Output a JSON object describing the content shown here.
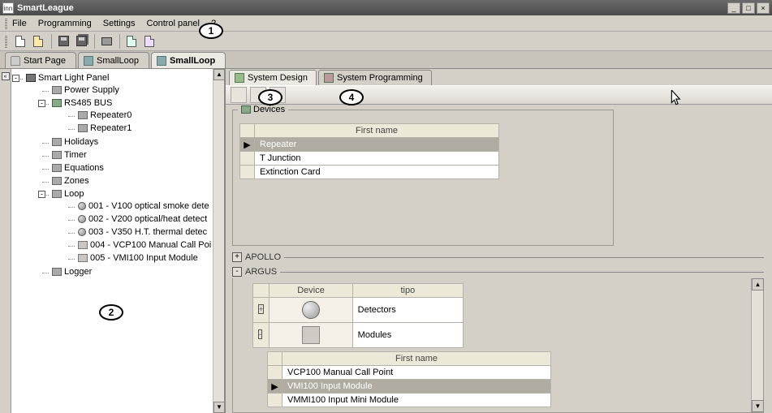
{
  "window": {
    "title": "SmartLeague",
    "appicon_text": "inn"
  },
  "menu": {
    "items": [
      "File",
      "Programming",
      "Settings",
      "Control panel",
      "?"
    ]
  },
  "callouts": {
    "c1": "1",
    "c2": "2",
    "c3": "3",
    "c4": "4"
  },
  "docTabs": [
    {
      "id": "startpage",
      "label": "Start Page",
      "active": false,
      "icon": "home-icon"
    },
    {
      "id": "smallloop1",
      "label": "SmallLoop",
      "active": false,
      "icon": "panel-icon"
    },
    {
      "id": "smallloop2",
      "label": "SmallLoop",
      "active": true,
      "icon": "panel-icon"
    }
  ],
  "tree": {
    "root": {
      "label": "Smart Light Panel",
      "children": [
        {
          "label": "Power Supply",
          "icon": "item"
        },
        {
          "label": "RS485 BUS",
          "icon": "bus",
          "expander": "-",
          "children": [
            {
              "label": "Repeater0",
              "icon": "item"
            },
            {
              "label": "Repeater1",
              "icon": "item"
            }
          ]
        },
        {
          "label": "Holidays",
          "icon": "item"
        },
        {
          "label": "Timer",
          "icon": "item"
        },
        {
          "label": "Equations",
          "icon": "item"
        },
        {
          "label": "Zones",
          "icon": "item"
        },
        {
          "label": "Loop",
          "icon": "item",
          "expander": "-",
          "children": [
            {
              "label": "001 - V100 optical smoke dete",
              "icon": "ball"
            },
            {
              "label": "002 - V200 optical/heat detect",
              "icon": "ball"
            },
            {
              "label": "003 - V350 H.T. thermal detec",
              "icon": "ball"
            },
            {
              "label": "004 - VCP100 Manual Call Poi",
              "icon": "mod"
            },
            {
              "label": "005 - VMI100 Input Module",
              "icon": "mod"
            }
          ]
        },
        {
          "label": "Logger",
          "icon": "item"
        }
      ]
    }
  },
  "subtabs": {
    "design": "System Design",
    "programming": "System Programming"
  },
  "devicesBox": {
    "title": "Devices",
    "col": "First name",
    "rows": [
      "Repeater",
      "T Junction",
      "Extinction Card"
    ],
    "selectedIndex": 0
  },
  "accordion": {
    "apollo": {
      "label": "APOLLO",
      "state": "+"
    },
    "argus": {
      "label": "ARGUS",
      "state": "-"
    }
  },
  "argusGrid": {
    "col_device": "Device",
    "col_tipo": "tipo",
    "rows": [
      {
        "tipo": "Detectors",
        "img": "ball",
        "exp": "+"
      },
      {
        "tipo": "Modules",
        "img": "mod",
        "exp": "-"
      }
    ]
  },
  "modulesGrid": {
    "col": "First name",
    "rows": [
      "VCP100 Manual Call Point",
      "VMI100 Input Module",
      "VMMI100 Input Mini Module"
    ],
    "selectedIndex": 1
  }
}
